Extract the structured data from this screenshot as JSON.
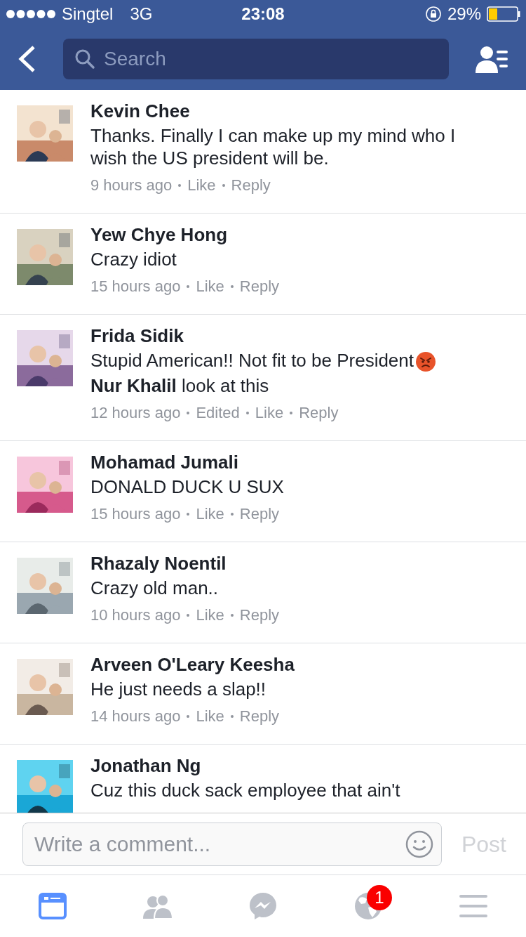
{
  "status_bar": {
    "carrier": "Singtel",
    "network": "3G",
    "time": "23:08",
    "battery": "29%"
  },
  "nav": {
    "search": {
      "placeholder": "Search"
    }
  },
  "comments": [
    {
      "name": "Kevin Chee",
      "lines": [
        {
          "text": "Thanks. Finally I can make up my mind who I wish the US president will be."
        }
      ],
      "meta": [
        "9 hours ago",
        "Like",
        "Reply"
      ]
    },
    {
      "name": "Yew Chye Hong",
      "lines": [
        {
          "text": "Crazy idiot"
        }
      ],
      "meta": [
        "15 hours ago",
        "Like",
        "Reply"
      ]
    },
    {
      "name": "Frida Sidik",
      "lines": [
        {
          "text": "Stupid American!! Not fit to be President",
          "kind": "with-angry-emoji"
        },
        {
          "text": "**Nur Khalil** look at this"
        }
      ],
      "meta": [
        "12 hours ago",
        "Edited",
        "Like",
        "Reply"
      ]
    },
    {
      "name": "Mohamad Jumali",
      "lines": [
        {
          "text": "DONALD DUCK U SUX"
        }
      ],
      "meta": [
        "15 hours ago",
        "Like",
        "Reply"
      ]
    },
    {
      "name": "Rhazaly Noentil",
      "lines": [
        {
          "text": "Crazy old man.."
        }
      ],
      "meta": [
        "10 hours ago",
        "Like",
        "Reply"
      ]
    },
    {
      "name": "Arveen O'Leary Keesha",
      "lines": [
        {
          "text": "He just needs a slap!!"
        }
      ],
      "meta": [
        "14 hours ago",
        "Like",
        "Reply"
      ]
    },
    {
      "name": "Jonathan Ng",
      "lines": [
        {
          "text": "Cuz this duck sack employee that ain't"
        }
      ]
    }
  ],
  "composer": {
    "placeholder": "Write a comment...",
    "post": {
      "label": "Post",
      "disabled": true
    }
  },
  "tab_bar": [
    {
      "kind": "feed",
      "selected": true
    },
    {
      "kind": "friends",
      "selected": false
    },
    {
      "kind": "messenger",
      "selected": false
    },
    {
      "kind": "globe",
      "selected": false,
      "badge": "1"
    },
    {
      "kind": "menu",
      "selected": false
    }
  ]
}
